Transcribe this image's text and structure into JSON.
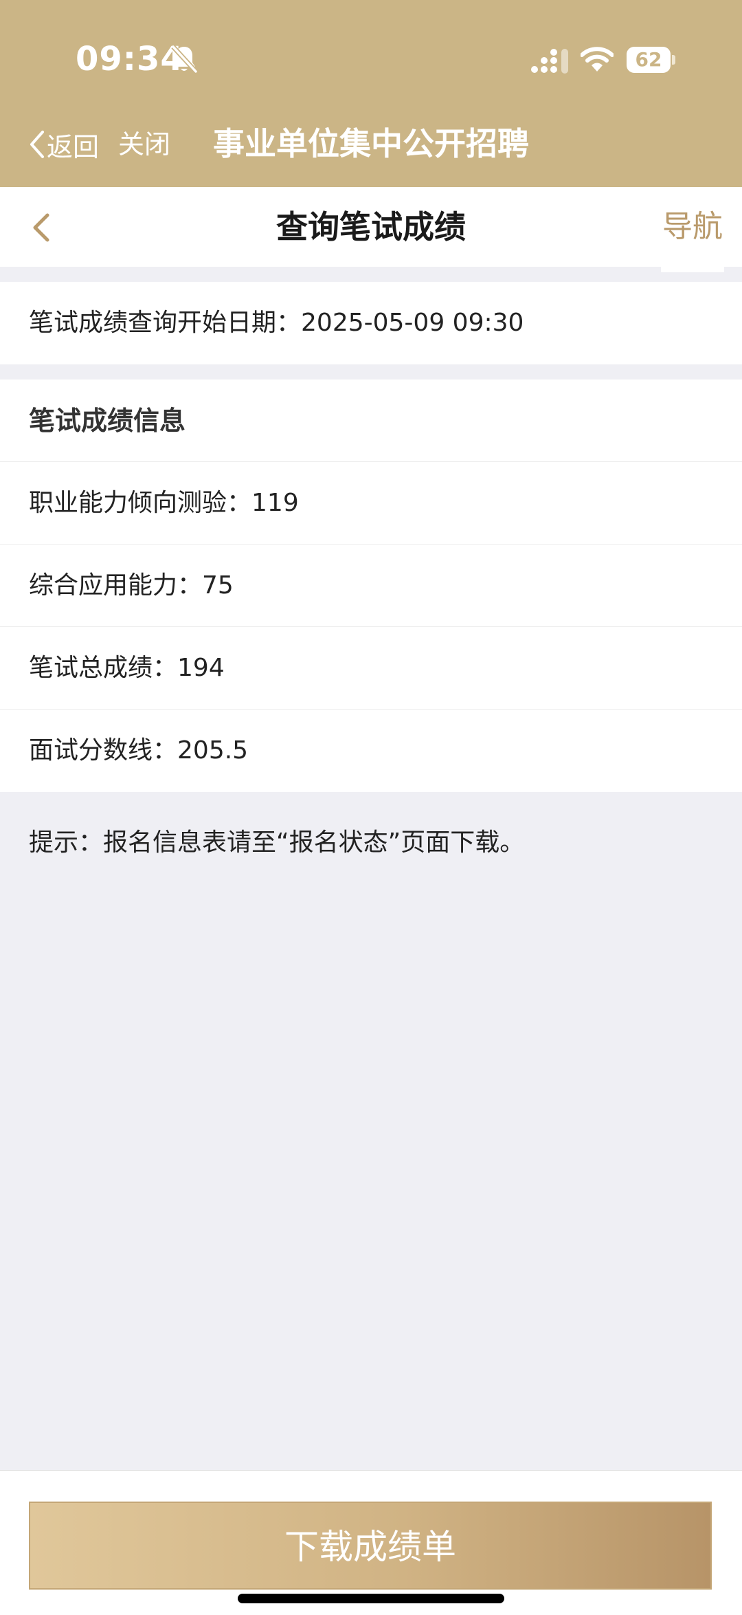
{
  "status_bar": {
    "time": "09:34",
    "battery": "62",
    "icons": [
      "bell-off-icon",
      "signal-icon",
      "wifi-icon",
      "battery-icon"
    ]
  },
  "webview_header": {
    "back_label": "返回",
    "close_label": "关闭",
    "title": "事业单位集中公开招聘"
  },
  "navbar": {
    "title": "查询笔试成绩",
    "guide_label": "导航"
  },
  "query_start": {
    "label": "笔试成绩查询开始日期：",
    "value": "2025-05-09 09:30"
  },
  "scores": {
    "header": "笔试成绩信息",
    "items": [
      {
        "label": "职业能力倾向测验：",
        "value": "119"
      },
      {
        "label": "综合应用能力：",
        "value": "75"
      },
      {
        "label": "笔试总成绩：",
        "value": "194"
      },
      {
        "label": "面试分数线：",
        "value": "205.5"
      }
    ]
  },
  "hint": "提示：报名信息表请至“报名状态”页面下载。",
  "download_button": "下载成绩单",
  "colors": {
    "header_gold": "#cbb586",
    "accent": "#b99a6b",
    "background": "#efeff4"
  }
}
